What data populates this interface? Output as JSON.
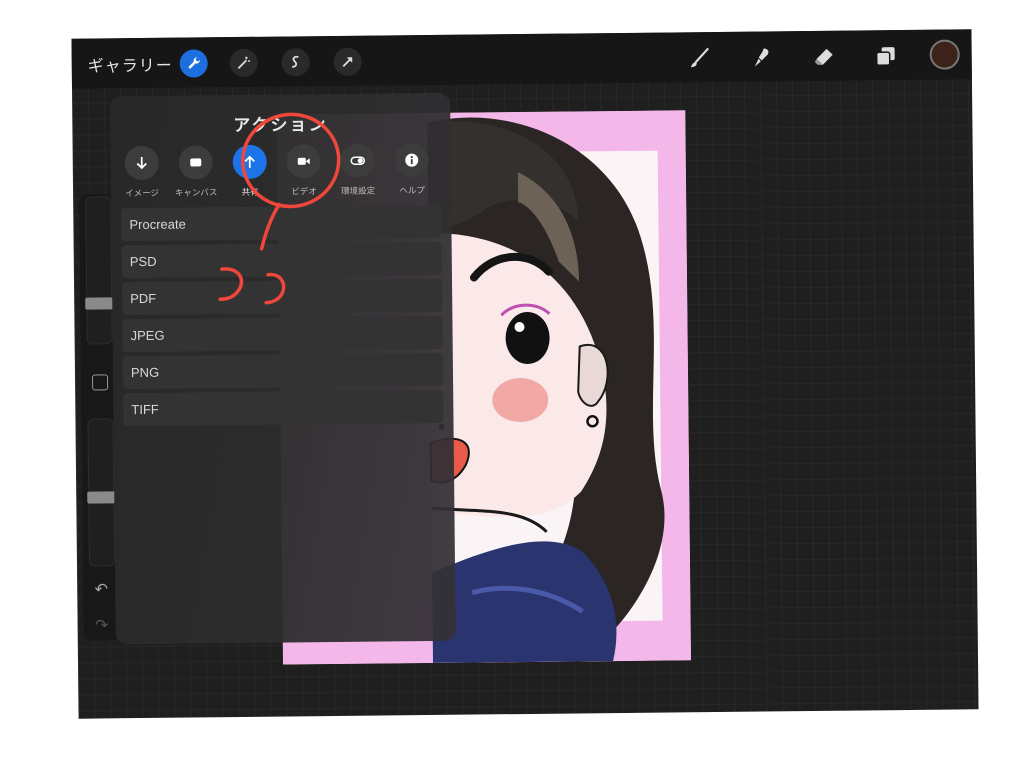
{
  "topbar": {
    "gallery_label": "ギャラリー",
    "left_tools": [
      "actions-wrench-icon",
      "adjustments-wand-icon",
      "selection-icon",
      "transform-arrow-icon"
    ],
    "right_tools": [
      "brush-icon",
      "smudge-icon",
      "eraser-icon",
      "layers-icon"
    ],
    "current_color": "#3d2219",
    "accent": "#1d6fe0"
  },
  "sidebar": {
    "controls": [
      "brush-size-slider",
      "modify-button",
      "opacity-slider",
      "undo-icon",
      "redo-icon"
    ]
  },
  "actions": {
    "title": "アクション",
    "categories": [
      {
        "label": "イメージ",
        "icon": "insert-arrow-down-icon"
      },
      {
        "label": "キャンバス",
        "icon": "canvas-icon"
      },
      {
        "label": "共有",
        "icon": "share-arrow-up-icon",
        "active": true
      },
      {
        "label": "ビデオ",
        "icon": "video-camera-icon"
      },
      {
        "label": "環境設定",
        "icon": "toggle-icon"
      },
      {
        "label": "ヘルプ",
        "icon": "info-icon"
      }
    ],
    "formats": [
      "Procreate",
      "PSD",
      "PDF",
      "JPEG",
      "PNG",
      "TIFF"
    ]
  },
  "annotation_color": "#f0473b"
}
